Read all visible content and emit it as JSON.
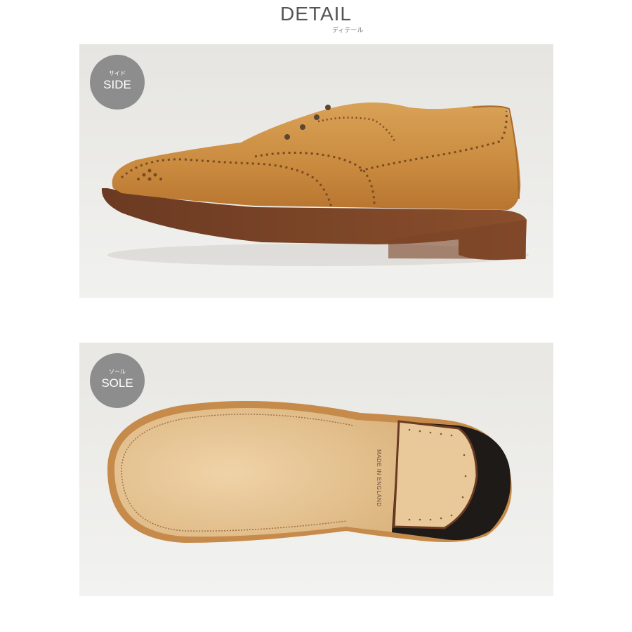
{
  "header": {
    "title": "DETAIL",
    "subtitle": "ディテール"
  },
  "panels": [
    {
      "badge_kana": "サイド",
      "badge_label": "SIDE"
    },
    {
      "badge_kana": "ソール",
      "badge_label": "SOLE"
    }
  ],
  "sole_stamp": "MADE IN ENGLAND",
  "colors": {
    "leather": "#c98a3e",
    "sole_leather": "#e9c99a",
    "heel_rubber": "#1e1a17",
    "welt": "#5a3320",
    "badge": "#8d8d8d",
    "background": "#ececea"
  }
}
